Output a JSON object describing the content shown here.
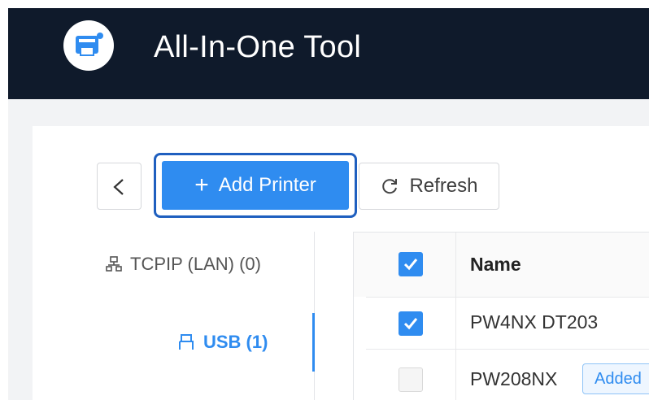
{
  "app": {
    "title": "All-In-One Tool",
    "logo_icon": "printer-logo-icon"
  },
  "toolbar": {
    "back_icon": "chevron-left-icon",
    "add_label": "Add Printer",
    "add_icon": "+",
    "refresh_label": "Refresh",
    "refresh_icon": "refresh-icon"
  },
  "sidebar": {
    "items": [
      {
        "label": "TCPIP (LAN) (0)",
        "icon": "network-icon",
        "active": false
      },
      {
        "label": "USB (1)",
        "icon": "usb-icon",
        "active": true
      }
    ]
  },
  "table": {
    "header": {
      "name": "Name",
      "checked": true
    },
    "rows": [
      {
        "name": "PW4NX DT203",
        "checked": true,
        "badge": ""
      },
      {
        "name": "PW208NX",
        "checked": false,
        "badge": "Added"
      }
    ]
  },
  "colors": {
    "accent": "#2f8cf0",
    "titlebar": "#0f1a2b",
    "focus_ring": "#1f5fbf"
  }
}
